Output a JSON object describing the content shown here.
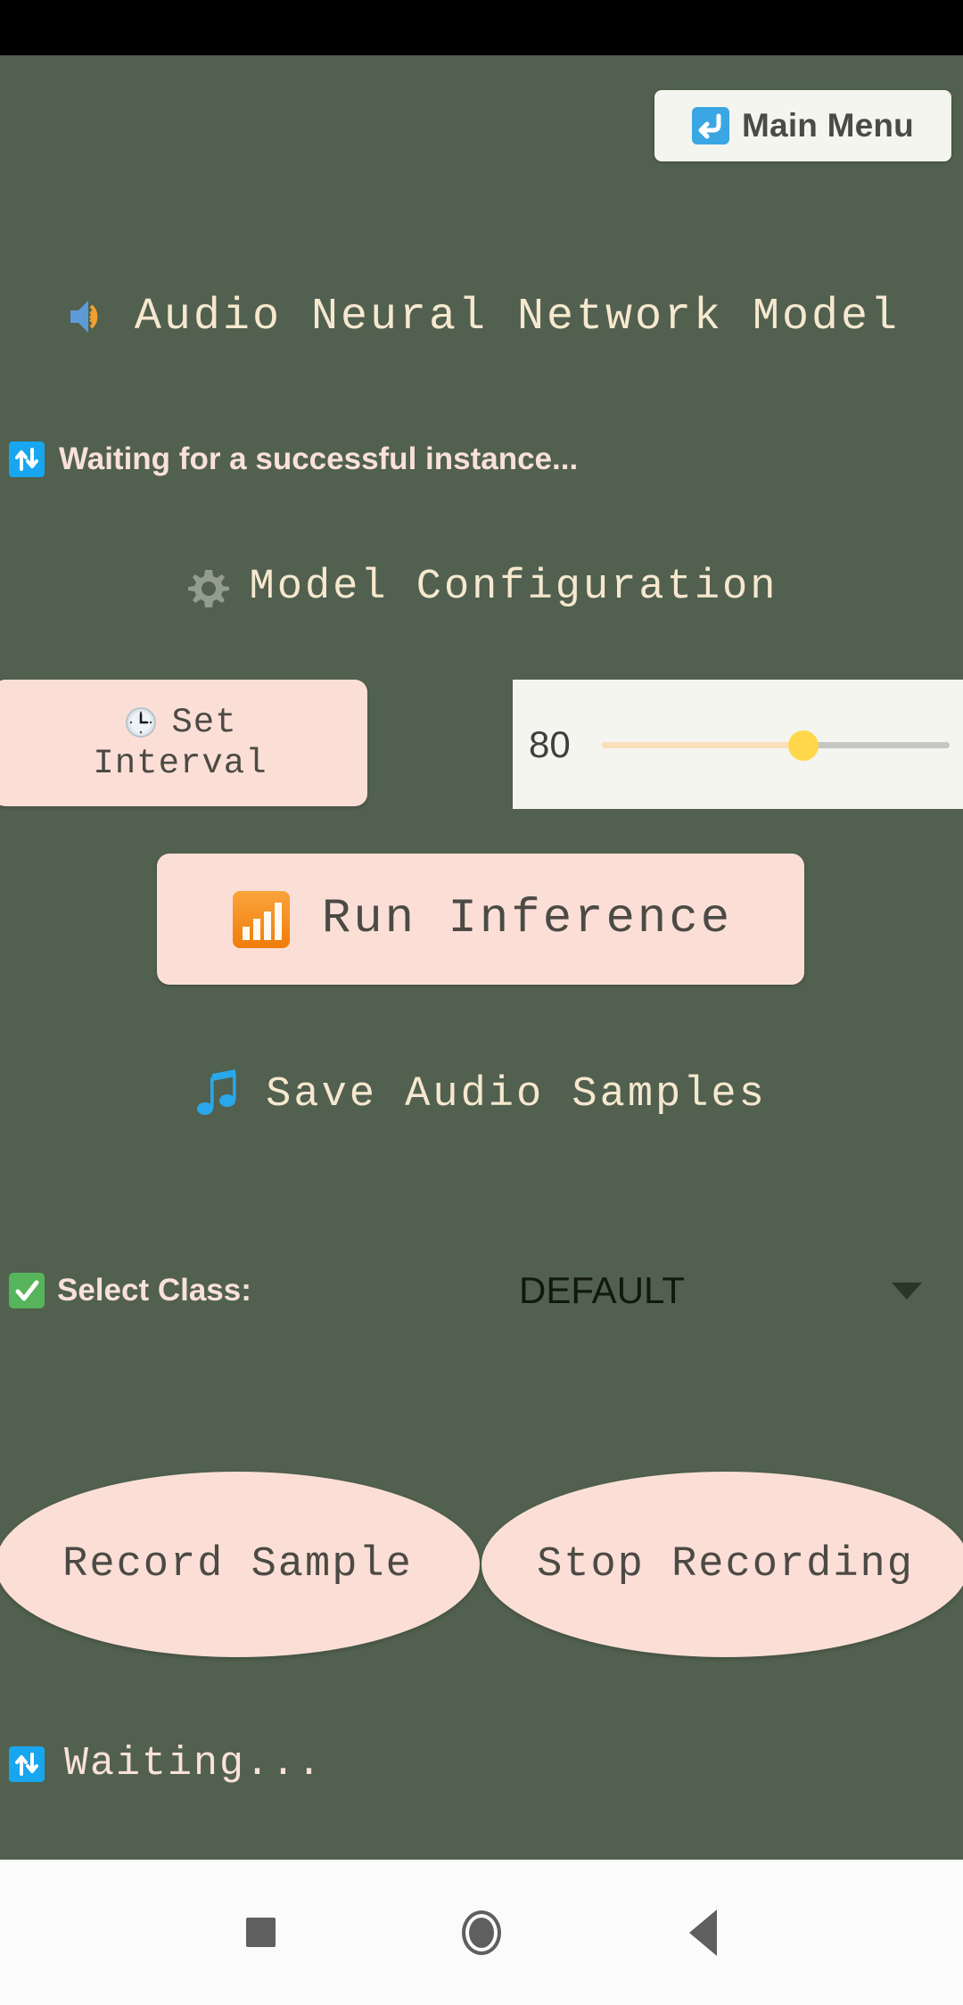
{
  "colors": {
    "background": "#51604f",
    "accent_pink": "#fbdfd6",
    "panel": "#f4f5ef",
    "title_text": "#f6e8cf",
    "body_text": "#f9e1d8",
    "button_text": "#4c4a45",
    "slider_thumb": "#ffd74b",
    "slider_fill": "#fadfbc",
    "slider_rail": "#c6c6c2",
    "status_bar": "#000000",
    "nav_bar": "#fbfbfb"
  },
  "header": {
    "main_menu_label": "Main Menu",
    "main_menu_icon": "leftwards-arrow-with-hook-icon"
  },
  "app": {
    "title": "Audio Neural Network Model",
    "title_icon": "speaker-high-volume-icon"
  },
  "status_top": {
    "icon": "vertical-arrows-sync-icon",
    "text": "Waiting for a successful instance..."
  },
  "config": {
    "section_title": "Model Configuration",
    "section_icon": "gear-icon",
    "set_interval": {
      "icon": "clock-icon",
      "line1": "Set",
      "line2": "Interval"
    },
    "slider": {
      "value": "80",
      "min": 0,
      "max": 100,
      "fill_percent": 58
    },
    "run_inference": {
      "icon": "bar-chart-icon",
      "label": "Run Inference"
    }
  },
  "samples": {
    "section_title": "Save Audio Samples",
    "section_icon": "musical-notes-icon",
    "select_class": {
      "icon": "check-mark-button-icon",
      "label": "Select Class:",
      "value": "DEFAULT",
      "caret": "chevron-down-icon"
    },
    "record_label": "Record Sample",
    "stop_label": "Stop Recording"
  },
  "status_bottom": {
    "icon": "vertical-arrows-sync-icon",
    "text": "Waiting..."
  },
  "nav_bar": {
    "recents": "square-recents-icon",
    "home": "circle-home-icon",
    "back": "triangle-back-icon"
  }
}
